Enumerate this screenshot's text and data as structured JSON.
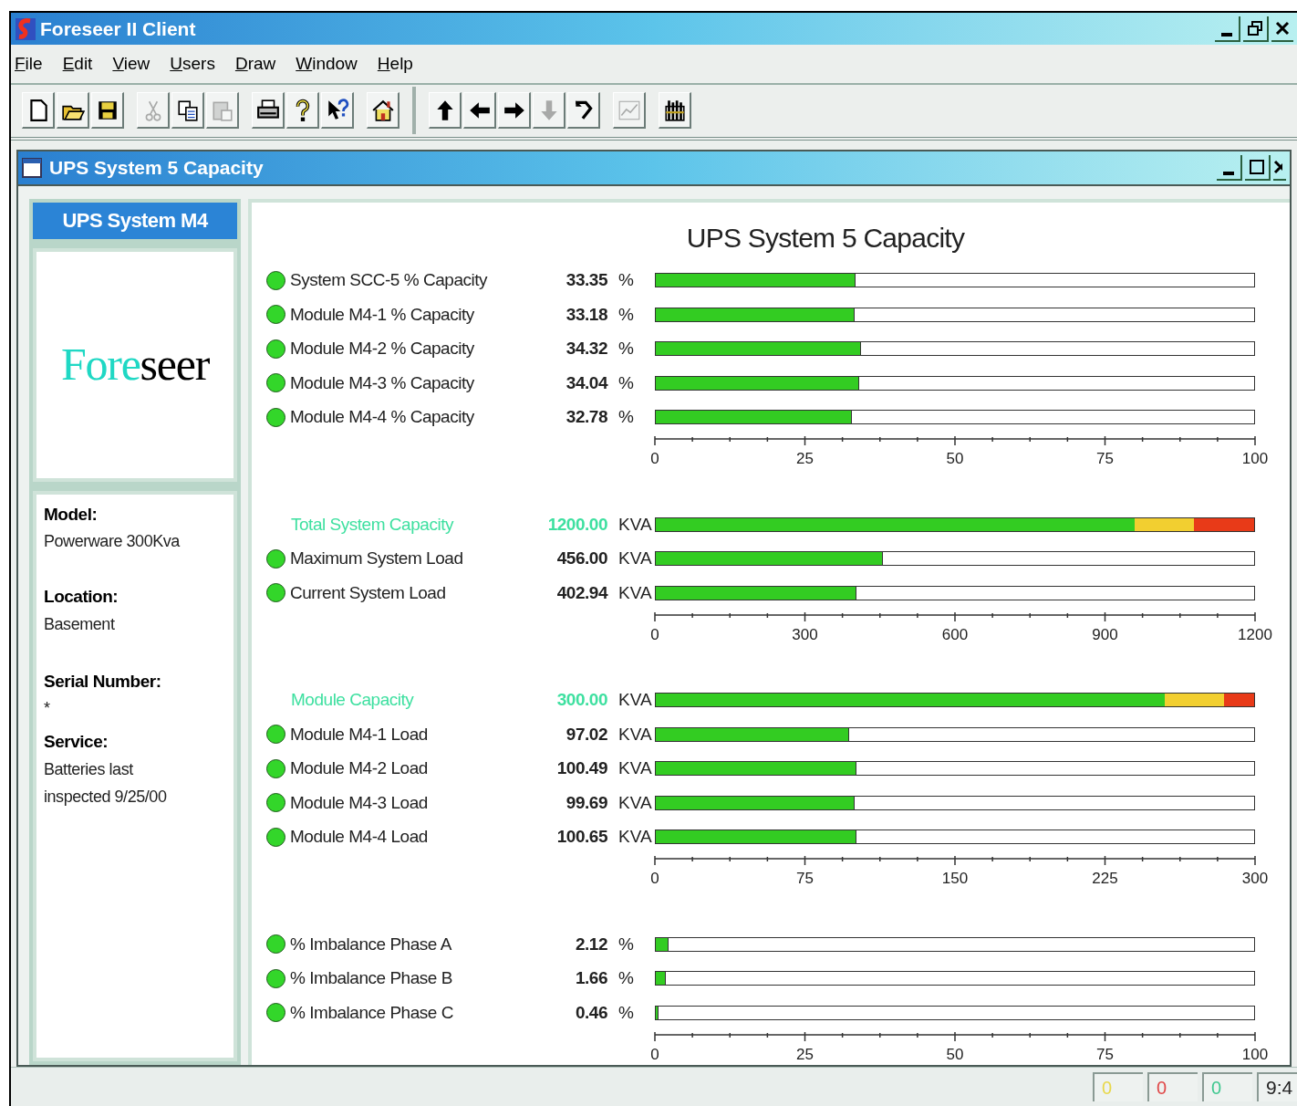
{
  "window": {
    "title": "Foreseer II Client"
  },
  "menu": [
    "File",
    "Edit",
    "View",
    "Users",
    "Draw",
    "Window",
    "Help"
  ],
  "toolbar": [
    [
      {
        "kind": "new",
        "disabled": false
      },
      {
        "kind": "open",
        "disabled": false
      },
      {
        "kind": "save",
        "disabled": false
      }
    ],
    [
      {
        "kind": "cut",
        "disabled": true
      },
      {
        "kind": "copy",
        "disabled": false
      },
      {
        "kind": "paste",
        "disabled": true
      }
    ],
    [
      {
        "kind": "print",
        "disabled": false
      },
      {
        "kind": "help",
        "disabled": false
      },
      {
        "kind": "context-help",
        "disabled": false
      }
    ],
    [
      {
        "kind": "home",
        "disabled": false
      }
    ],
    [
      {
        "kind": "up",
        "disabled": false
      },
      {
        "kind": "left",
        "disabled": false
      },
      {
        "kind": "right",
        "disabled": false
      },
      {
        "kind": "down",
        "disabled": true
      },
      {
        "kind": "back",
        "disabled": false
      }
    ],
    [
      {
        "kind": "chart",
        "disabled": true
      }
    ],
    [
      {
        "kind": "tools",
        "disabled": false
      }
    ]
  ],
  "child_window": {
    "title": "UPS System 5 Capacity"
  },
  "sidebar": {
    "header": "UPS System M4",
    "logo": {
      "part_1": "Fore",
      "part_2": "seer"
    },
    "fields": [
      {
        "label": "Model:",
        "value": "Powerware 300Kva"
      },
      {
        "label": "Location:",
        "value": "Basement"
      },
      {
        "label": "Serial Number:",
        "value": "*"
      },
      {
        "label": "Service:",
        "value": "Batteries last inspected 9/25/00"
      }
    ]
  },
  "panel": {
    "title": "UPS System 5 Capacity",
    "groups": [
      {
        "rows": [
          {
            "kind": "meter",
            "label": "System SCC-5 % Capacity",
            "value": "33.35",
            "unit": "%",
            "level": 0.3335
          },
          {
            "kind": "meter",
            "label": "Module M4-1 % Capacity",
            "value": "33.18",
            "unit": "%",
            "level": 0.3318
          },
          {
            "kind": "meter",
            "label": "Module M4-2 % Capacity",
            "value": "34.32",
            "unit": "%",
            "level": 0.3432
          },
          {
            "kind": "meter",
            "label": "Module M4-3 % Capacity",
            "value": "34.04",
            "unit": "%",
            "level": 0.3404
          },
          {
            "kind": "meter",
            "label": "Module M4-4 % Capacity",
            "value": "32.78",
            "unit": "%",
            "level": 0.3278
          }
        ],
        "ticks": [
          "0",
          "25",
          "50",
          "75",
          "100"
        ]
      },
      {
        "rows": [
          {
            "kind": "reference",
            "label": "Total System Capacity",
            "value": "1200.00",
            "unit": "KVA",
            "segments": [
              {
                "color": "#33cc22",
                "level": 0.8
              },
              {
                "color": "#f2cf30"
              },
              {
                "color": "#e83a18",
                "level": 0.1
              }
            ]
          },
          {
            "kind": "meter",
            "label": "Maximum System Load",
            "value": "456.00",
            "unit": "KVA",
            "level": 0.38
          },
          {
            "kind": "meter",
            "label": "Current System Load",
            "value": "402.94",
            "unit": "KVA",
            "level": 0.3358
          }
        ],
        "ticks": [
          "0",
          "300",
          "600",
          "900",
          "1200"
        ]
      },
      {
        "rows": [
          {
            "kind": "reference",
            "label": "Module Capacity",
            "value": "300.00",
            "unit": "KVA",
            "segments": [
              {
                "color": "#33cc22",
                "level": 0.85
              },
              {
                "color": "#f2cf30"
              },
              {
                "color": "#e83a18",
                "level": 0.05
              }
            ]
          },
          {
            "kind": "meter",
            "label": "Module M4-1 Load",
            "value": "97.02",
            "unit": "KVA",
            "level": 0.3234
          },
          {
            "kind": "meter",
            "label": "Module M4-2 Load",
            "value": "100.49",
            "unit": "KVA",
            "level": 0.335
          },
          {
            "kind": "meter",
            "label": "Module M4-3 Load",
            "value": "99.69",
            "unit": "KVA",
            "level": 0.3323
          },
          {
            "kind": "meter",
            "label": "Module M4-4 Load",
            "value": "100.65",
            "unit": "KVA",
            "level": 0.3355
          }
        ],
        "ticks": [
          "0",
          "75",
          "150",
          "225",
          "300"
        ]
      },
      {
        "rows": [
          {
            "kind": "meter",
            "label": "% Imbalance Phase A",
            "value": "2.12",
            "unit": "%",
            "level": 0.0212
          },
          {
            "kind": "meter",
            "label": "% Imbalance Phase B",
            "value": "1.66",
            "unit": "%",
            "level": 0.0166
          },
          {
            "kind": "meter",
            "label": "% Imbalance Phase C",
            "value": "0.46",
            "unit": "%",
            "level": 0.0046
          }
        ],
        "ticks": [
          "0",
          "25",
          "50",
          "75",
          "100"
        ]
      }
    ]
  },
  "status_bar": {
    "counters": [
      {
        "value": "0",
        "color": "#e8d84a"
      },
      {
        "value": "0",
        "color": "#e04848"
      },
      {
        "value": "0",
        "color": "#40c890"
      }
    ],
    "time": "9:4"
  }
}
